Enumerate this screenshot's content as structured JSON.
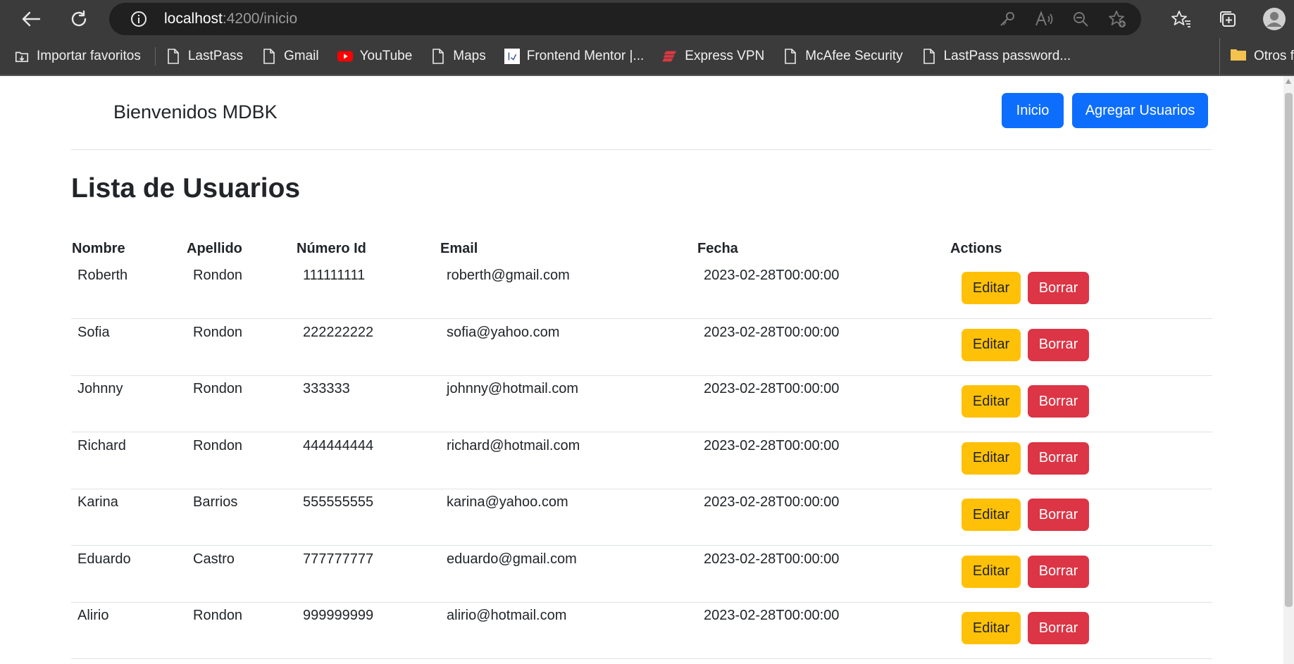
{
  "browser": {
    "url_host": "localhost",
    "url_path": ":4200/inicio",
    "bookmarks": [
      {
        "label": "Importar favoritos",
        "icon": "import-icon"
      },
      {
        "label": "LastPass",
        "icon": "page-icon"
      },
      {
        "label": "Gmail",
        "icon": "page-icon"
      },
      {
        "label": "YouTube",
        "icon": "youtube-icon"
      },
      {
        "label": "Maps",
        "icon": "page-icon"
      },
      {
        "label": "Frontend Mentor |...",
        "icon": "frontend-mentor-icon"
      },
      {
        "label": "Express VPN",
        "icon": "expressvpn-icon"
      },
      {
        "label": "McAfee Security",
        "icon": "page-icon"
      },
      {
        "label": "LastPass password...",
        "icon": "page-icon"
      }
    ],
    "other_favorites": "Otros f"
  },
  "header": {
    "brand": "Bienvenidos MDBK",
    "btn_inicio": "Inicio",
    "btn_agregar": "Agregar Usuarios"
  },
  "main": {
    "title": "Lista de Usuarios",
    "columns": [
      "Nombre",
      "Apellido",
      "Número Id",
      "Email",
      "Fecha",
      "Actions"
    ],
    "edit_label": "Editar",
    "delete_label": "Borrar",
    "rows": [
      {
        "nombre": "Roberth",
        "apellido": "Rondon",
        "id": "111111111",
        "email": "roberth@gmail.com",
        "fecha": "2023-02-28T00:00:00"
      },
      {
        "nombre": "Sofia",
        "apellido": "Rondon",
        "id": "222222222",
        "email": "sofia@yahoo.com",
        "fecha": "2023-02-28T00:00:00"
      },
      {
        "nombre": "Johnny",
        "apellido": "Rondon",
        "id": "333333",
        "email": "johnny@hotmail.com",
        "fecha": "2023-02-28T00:00:00"
      },
      {
        "nombre": "Richard",
        "apellido": "Rondon",
        "id": "444444444",
        "email": "richard@hotmail.com",
        "fecha": "2023-02-28T00:00:00"
      },
      {
        "nombre": "Karina",
        "apellido": "Barrios",
        "id": "555555555",
        "email": "karina@yahoo.com",
        "fecha": "2023-02-28T00:00:00"
      },
      {
        "nombre": "Eduardo",
        "apellido": "Castro",
        "id": "777777777",
        "email": "eduardo@gmail.com",
        "fecha": "2023-02-28T00:00:00"
      },
      {
        "nombre": "Alirio",
        "apellido": "Rondon",
        "id": "999999999",
        "email": "alirio@hotmail.com",
        "fecha": "2023-02-28T00:00:00"
      }
    ]
  },
  "colors": {
    "primary": "#0d6efd",
    "warning": "#ffc107",
    "danger": "#dc3545",
    "browser_bg": "#3b3b3b",
    "address_bg": "#202020"
  }
}
